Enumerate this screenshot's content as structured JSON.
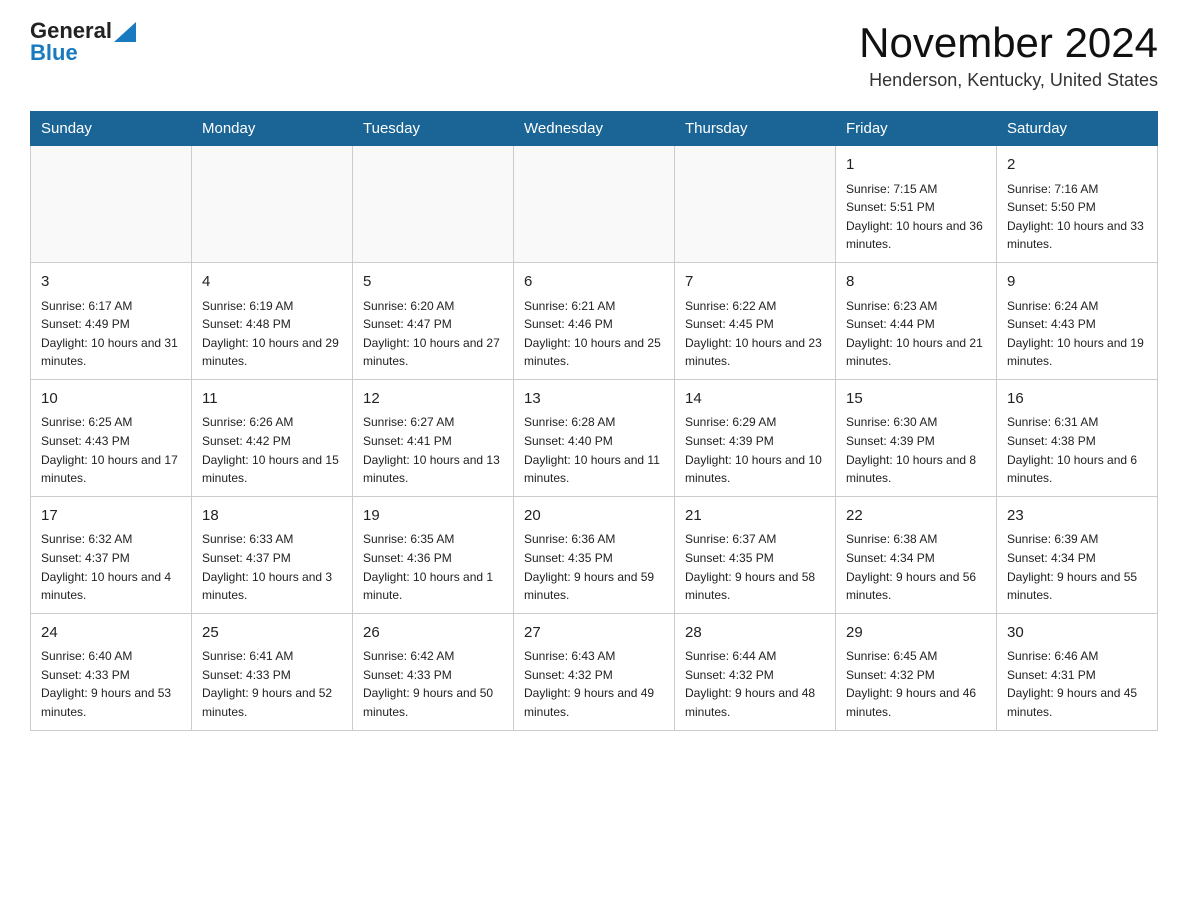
{
  "header": {
    "logo_general": "General",
    "logo_blue": "Blue",
    "month_title": "November 2024",
    "location": "Henderson, Kentucky, United States"
  },
  "weekdays": [
    "Sunday",
    "Monday",
    "Tuesday",
    "Wednesday",
    "Thursday",
    "Friday",
    "Saturday"
  ],
  "weeks": [
    [
      {
        "day": "",
        "sunrise": "",
        "sunset": "",
        "daylight": ""
      },
      {
        "day": "",
        "sunrise": "",
        "sunset": "",
        "daylight": ""
      },
      {
        "day": "",
        "sunrise": "",
        "sunset": "",
        "daylight": ""
      },
      {
        "day": "",
        "sunrise": "",
        "sunset": "",
        "daylight": ""
      },
      {
        "day": "",
        "sunrise": "",
        "sunset": "",
        "daylight": ""
      },
      {
        "day": "1",
        "sunrise": "Sunrise: 7:15 AM",
        "sunset": "Sunset: 5:51 PM",
        "daylight": "Daylight: 10 hours and 36 minutes."
      },
      {
        "day": "2",
        "sunrise": "Sunrise: 7:16 AM",
        "sunset": "Sunset: 5:50 PM",
        "daylight": "Daylight: 10 hours and 33 minutes."
      }
    ],
    [
      {
        "day": "3",
        "sunrise": "Sunrise: 6:17 AM",
        "sunset": "Sunset: 4:49 PM",
        "daylight": "Daylight: 10 hours and 31 minutes."
      },
      {
        "day": "4",
        "sunrise": "Sunrise: 6:19 AM",
        "sunset": "Sunset: 4:48 PM",
        "daylight": "Daylight: 10 hours and 29 minutes."
      },
      {
        "day": "5",
        "sunrise": "Sunrise: 6:20 AM",
        "sunset": "Sunset: 4:47 PM",
        "daylight": "Daylight: 10 hours and 27 minutes."
      },
      {
        "day": "6",
        "sunrise": "Sunrise: 6:21 AM",
        "sunset": "Sunset: 4:46 PM",
        "daylight": "Daylight: 10 hours and 25 minutes."
      },
      {
        "day": "7",
        "sunrise": "Sunrise: 6:22 AM",
        "sunset": "Sunset: 4:45 PM",
        "daylight": "Daylight: 10 hours and 23 minutes."
      },
      {
        "day": "8",
        "sunrise": "Sunrise: 6:23 AM",
        "sunset": "Sunset: 4:44 PM",
        "daylight": "Daylight: 10 hours and 21 minutes."
      },
      {
        "day": "9",
        "sunrise": "Sunrise: 6:24 AM",
        "sunset": "Sunset: 4:43 PM",
        "daylight": "Daylight: 10 hours and 19 minutes."
      }
    ],
    [
      {
        "day": "10",
        "sunrise": "Sunrise: 6:25 AM",
        "sunset": "Sunset: 4:43 PM",
        "daylight": "Daylight: 10 hours and 17 minutes."
      },
      {
        "day": "11",
        "sunrise": "Sunrise: 6:26 AM",
        "sunset": "Sunset: 4:42 PM",
        "daylight": "Daylight: 10 hours and 15 minutes."
      },
      {
        "day": "12",
        "sunrise": "Sunrise: 6:27 AM",
        "sunset": "Sunset: 4:41 PM",
        "daylight": "Daylight: 10 hours and 13 minutes."
      },
      {
        "day": "13",
        "sunrise": "Sunrise: 6:28 AM",
        "sunset": "Sunset: 4:40 PM",
        "daylight": "Daylight: 10 hours and 11 minutes."
      },
      {
        "day": "14",
        "sunrise": "Sunrise: 6:29 AM",
        "sunset": "Sunset: 4:39 PM",
        "daylight": "Daylight: 10 hours and 10 minutes."
      },
      {
        "day": "15",
        "sunrise": "Sunrise: 6:30 AM",
        "sunset": "Sunset: 4:39 PM",
        "daylight": "Daylight: 10 hours and 8 minutes."
      },
      {
        "day": "16",
        "sunrise": "Sunrise: 6:31 AM",
        "sunset": "Sunset: 4:38 PM",
        "daylight": "Daylight: 10 hours and 6 minutes."
      }
    ],
    [
      {
        "day": "17",
        "sunrise": "Sunrise: 6:32 AM",
        "sunset": "Sunset: 4:37 PM",
        "daylight": "Daylight: 10 hours and 4 minutes."
      },
      {
        "day": "18",
        "sunrise": "Sunrise: 6:33 AM",
        "sunset": "Sunset: 4:37 PM",
        "daylight": "Daylight: 10 hours and 3 minutes."
      },
      {
        "day": "19",
        "sunrise": "Sunrise: 6:35 AM",
        "sunset": "Sunset: 4:36 PM",
        "daylight": "Daylight: 10 hours and 1 minute."
      },
      {
        "day": "20",
        "sunrise": "Sunrise: 6:36 AM",
        "sunset": "Sunset: 4:35 PM",
        "daylight": "Daylight: 9 hours and 59 minutes."
      },
      {
        "day": "21",
        "sunrise": "Sunrise: 6:37 AM",
        "sunset": "Sunset: 4:35 PM",
        "daylight": "Daylight: 9 hours and 58 minutes."
      },
      {
        "day": "22",
        "sunrise": "Sunrise: 6:38 AM",
        "sunset": "Sunset: 4:34 PM",
        "daylight": "Daylight: 9 hours and 56 minutes."
      },
      {
        "day": "23",
        "sunrise": "Sunrise: 6:39 AM",
        "sunset": "Sunset: 4:34 PM",
        "daylight": "Daylight: 9 hours and 55 minutes."
      }
    ],
    [
      {
        "day": "24",
        "sunrise": "Sunrise: 6:40 AM",
        "sunset": "Sunset: 4:33 PM",
        "daylight": "Daylight: 9 hours and 53 minutes."
      },
      {
        "day": "25",
        "sunrise": "Sunrise: 6:41 AM",
        "sunset": "Sunset: 4:33 PM",
        "daylight": "Daylight: 9 hours and 52 minutes."
      },
      {
        "day": "26",
        "sunrise": "Sunrise: 6:42 AM",
        "sunset": "Sunset: 4:33 PM",
        "daylight": "Daylight: 9 hours and 50 minutes."
      },
      {
        "day": "27",
        "sunrise": "Sunrise: 6:43 AM",
        "sunset": "Sunset: 4:32 PM",
        "daylight": "Daylight: 9 hours and 49 minutes."
      },
      {
        "day": "28",
        "sunrise": "Sunrise: 6:44 AM",
        "sunset": "Sunset: 4:32 PM",
        "daylight": "Daylight: 9 hours and 48 minutes."
      },
      {
        "day": "29",
        "sunrise": "Sunrise: 6:45 AM",
        "sunset": "Sunset: 4:32 PM",
        "daylight": "Daylight: 9 hours and 46 minutes."
      },
      {
        "day": "30",
        "sunrise": "Sunrise: 6:46 AM",
        "sunset": "Sunset: 4:31 PM",
        "daylight": "Daylight: 9 hours and 45 minutes."
      }
    ]
  ]
}
